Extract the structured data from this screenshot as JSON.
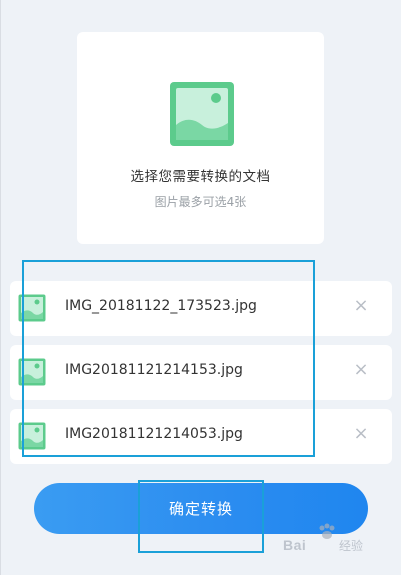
{
  "picker": {
    "title": "选择您需要转换的文档",
    "hint": "图片最多可选4张",
    "icon": "image-icon",
    "accent_color": "#5ccb8c"
  },
  "files": [
    {
      "name": "IMG_20181122_173523.jpg",
      "remove_icon": "close-icon"
    },
    {
      "name": "IMG20181121214153.jpg",
      "remove_icon": "close-icon"
    },
    {
      "name": "IMG20181121214053.jpg",
      "remove_icon": "close-icon"
    }
  ],
  "confirm_button": {
    "label": "确定转换",
    "color": "#2c8df0"
  },
  "annotation_color": "#1aa0d8",
  "watermark": {
    "brand": "Bai",
    "suffix": "经验",
    "logo": "paw-icon"
  }
}
